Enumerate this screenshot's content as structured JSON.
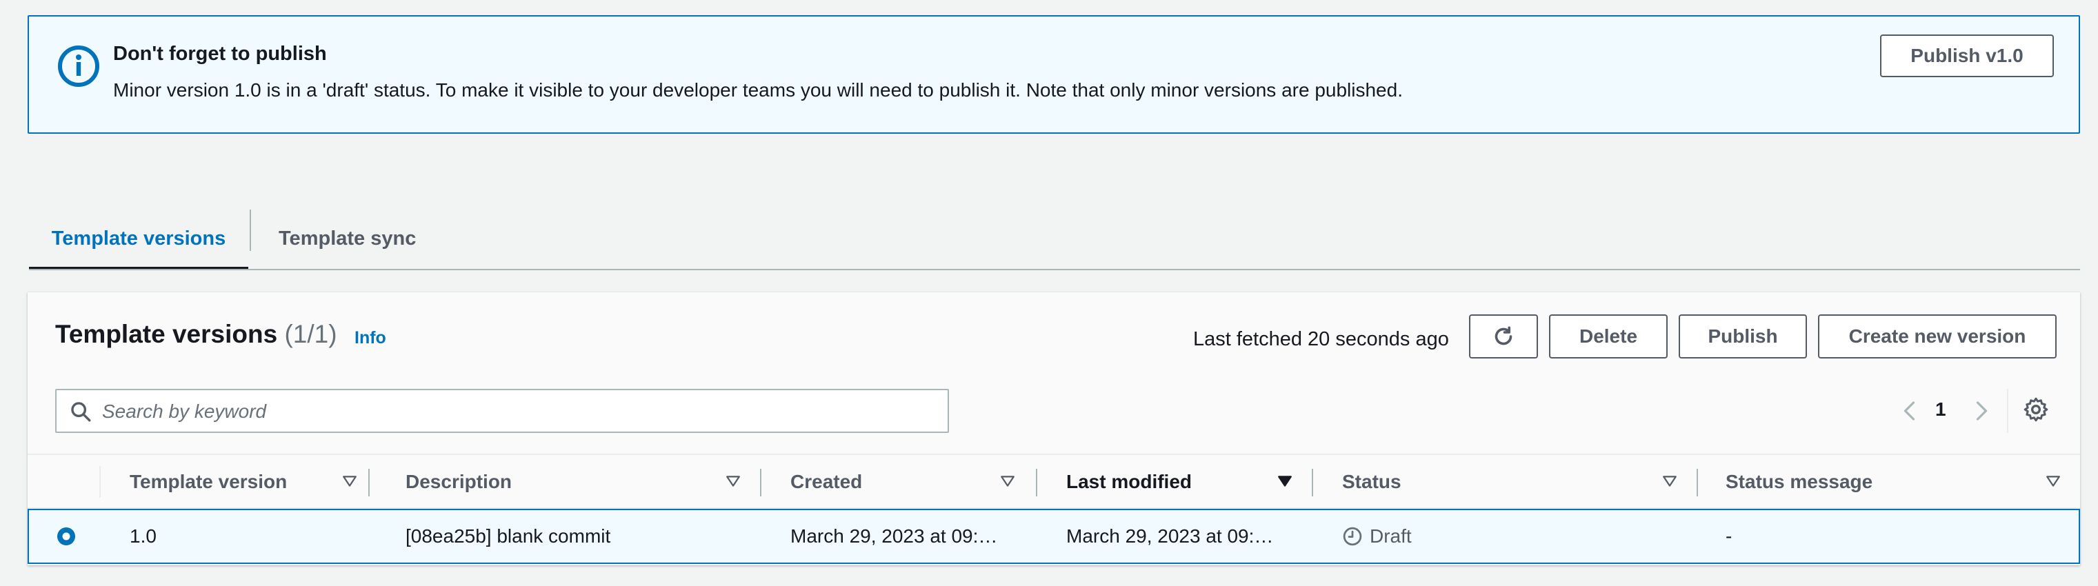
{
  "flash": {
    "title": "Don't forget to publish",
    "message": "Minor version 1.0 is in a 'draft' status. To make it visible to your developer teams you will need to publish it. Note that only minor versions are published.",
    "action_label": "Publish v1.0",
    "icon": "info-icon"
  },
  "tabs": [
    {
      "label": "Template versions",
      "active": true
    },
    {
      "label": "Template sync",
      "active": false
    }
  ],
  "panel": {
    "title": "Template versions",
    "count": "(1/1)",
    "info_label": "Info",
    "last_fetched": "Last fetched 20 seconds ago",
    "buttons": {
      "refresh_icon": "refresh-icon",
      "delete": "Delete",
      "publish": "Publish",
      "create": "Create new version"
    },
    "search": {
      "placeholder": "Search by keyword",
      "value": ""
    },
    "pagination": {
      "current_page": "1"
    }
  },
  "table": {
    "columns": [
      {
        "label": "Template version",
        "sorted": false
      },
      {
        "label": "Description",
        "sorted": false
      },
      {
        "label": "Created",
        "sorted": false
      },
      {
        "label": "Last modified",
        "sorted": true,
        "direction": "descending"
      },
      {
        "label": "Status",
        "sorted": false
      },
      {
        "label": "Status message",
        "sorted": false
      }
    ],
    "rows": [
      {
        "selected": true,
        "version": "1.0",
        "description": "[08ea25b] blank commit",
        "created": "March 29, 2023 at 09:…",
        "last_modified": "March 29, 2023 at 09:…",
        "status": "Draft",
        "status_icon": "clock-icon",
        "status_message": "-"
      }
    ]
  },
  "colors": {
    "accent": "#0073bb",
    "flash_bg": "#f1faff",
    "page_bg": "#f2f3f3",
    "text": "#16191f",
    "muted": "#545b64"
  }
}
